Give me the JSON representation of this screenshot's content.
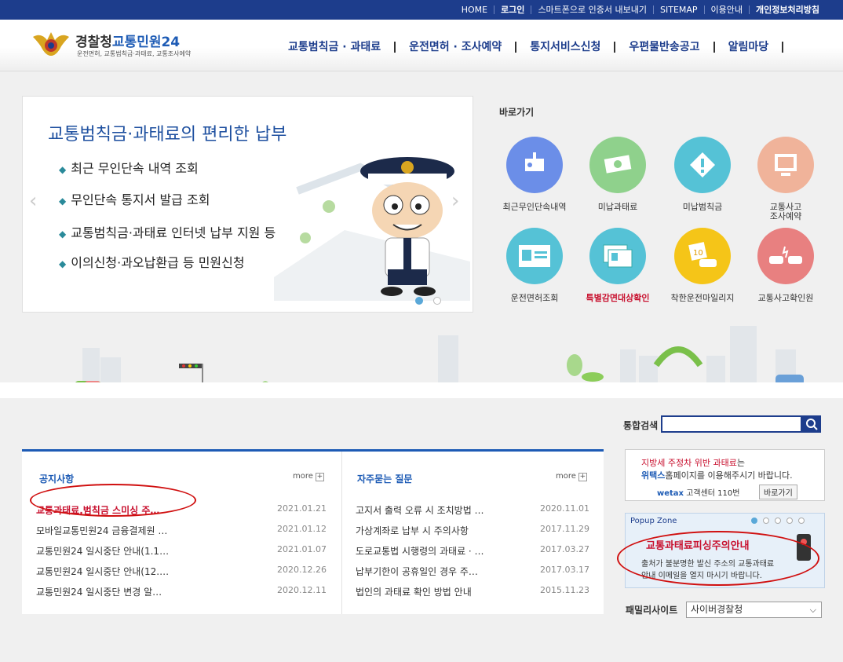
{
  "top_links": [
    "HOME",
    "로그인",
    "스마트폰으로 인증서 내보내기",
    "SITEMAP",
    "이용안내",
    "개인정보처리방침"
  ],
  "logo": {
    "title_main": "경찰청",
    "title_accent": "교통민원24",
    "subtitle": "운전면허, 교통범칙금·과태료, 교통조사예약"
  },
  "gnb": [
    "교통범칙금 · 과태료",
    "운전면허 · 조사예약",
    "통지서비스신청",
    "우편물반송공고",
    "알림마당"
  ],
  "slider": {
    "headline": "교통범칙금·과태료의 편리한 납부",
    "bullets": [
      "최근 무인단속 내역 조회",
      "무인단속 통지서 발급 조회",
      "교통범칙금·과태료 인터넷 납부 지원 등",
      "이의신청·과오납환급 등 민원신청"
    ]
  },
  "quick": {
    "title": "바로가기",
    "items": [
      {
        "label": "최근무인단속내역",
        "icon": "speed-camera-icon"
      },
      {
        "label": "미납과태료",
        "icon": "money-icon"
      },
      {
        "label": "미납범칙금",
        "icon": "warning-diamond-icon"
      },
      {
        "label": "교통사고\n조사예약",
        "icon": "computer-monitor-icon"
      },
      {
        "label": "운전면허조회",
        "icon": "license-card-icon"
      },
      {
        "label": "특별감면대상확인",
        "icon": "id-cards-icon"
      },
      {
        "label": "착한운전마일리지",
        "icon": "mileage-car-icon"
      },
      {
        "label": "교통사고확인원",
        "icon": "car-crash-icon"
      }
    ]
  },
  "search": {
    "label": "통합검색"
  },
  "notice": {
    "title": "공지사항",
    "more": "more",
    "rows": [
      {
        "title": "교통과태료,범칙금 스미싱 주…",
        "date": "2021.01.21"
      },
      {
        "title": "모바일교통민원24 금융결제원 …",
        "date": "2021.01.12"
      },
      {
        "title": "교통민원24 일시중단 안내(1.1…",
        "date": "2021.01.07"
      },
      {
        "title": "교통민원24 일시중단 안내(12.…",
        "date": "2020.12.26"
      },
      {
        "title": "교통민원24 일시중단 변경 알…",
        "date": "2020.12.11"
      }
    ]
  },
  "faq": {
    "title": "자주묻는 질문",
    "more": "more",
    "rows": [
      {
        "title": "고지서 출력 오류 시 조치방법 …",
        "date": "2020.11.01"
      },
      {
        "title": "가상계좌로 납부 시 주의사항",
        "date": "2017.11.29"
      },
      {
        "title": "도로교통법 시행령의 과태료 · …",
        "date": "2017.03.27"
      },
      {
        "title": "납부기한이 공휴일인 경우 주…",
        "date": "2017.03.17"
      },
      {
        "title": "법인의 과태료 확인 방법 안내",
        "date": "2015.11.23"
      }
    ]
  },
  "banner": {
    "line1_a": "지방세 주정차 위반 과태료",
    "line1_b": "는",
    "line2_a": "위택스",
    "line2_b": "홈페이지를 이용해주시기 바랍니다.",
    "brand": "wetax",
    "center": "고객센터 110번",
    "button": "바로가기"
  },
  "popup": {
    "label": "Popup Zone",
    "title": "교통과태료피싱주의안내",
    "body1": "출처가 불분명한 발신 주소의 교통과태료",
    "body2": "안내 이메일을 열지 마시기 바랍니다."
  },
  "family": {
    "label": "패밀리사이트",
    "selected": "사이버경찰청"
  },
  "colors": {
    "topbar": "#1d3d8c",
    "accent": "#1d5bb5",
    "alert_red": "#c8102e",
    "highlight_text": "#c8102e"
  }
}
